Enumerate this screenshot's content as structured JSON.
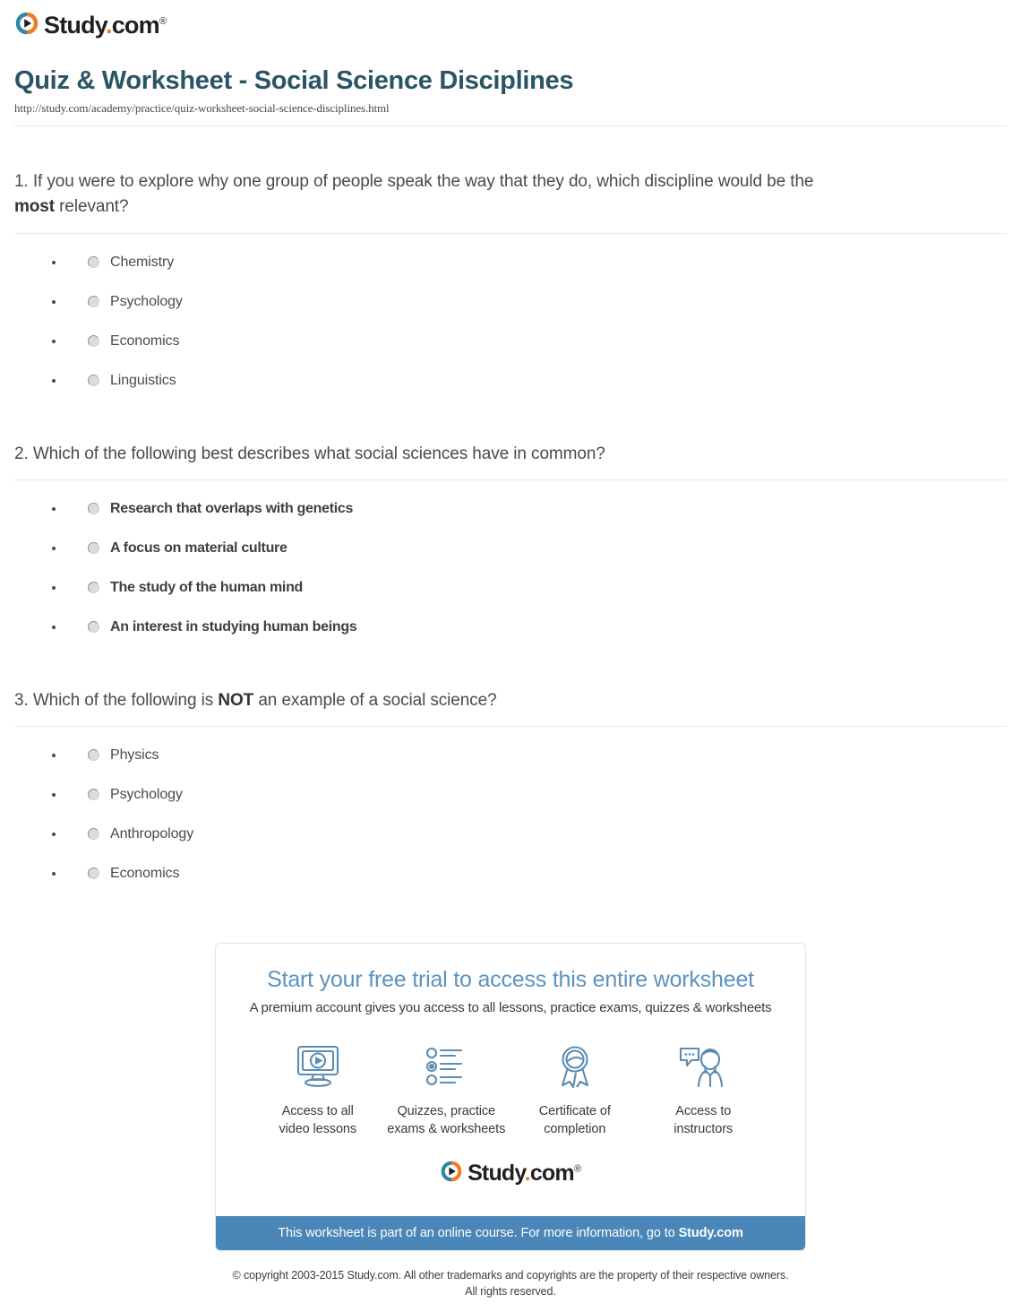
{
  "brand": {
    "name": "Study.com",
    "name_prefix": "Study",
    "name_dot": ".",
    "name_suffix": "com",
    "trademark": "®",
    "icon_name": "play-circle-logo-icon",
    "color_blue": "#2e86ab",
    "color_orange": "#f07c22"
  },
  "header": {
    "title": "Quiz & Worksheet - Social Science Disciplines",
    "url": "http://study.com/academy/practice/quiz-worksheet-social-science-disciplines.html"
  },
  "questions": [
    {
      "number": "1.",
      "text_before": "If you were to explore why one group of people speak the way that they do, which discipline would be the ",
      "emphasis": "most",
      "text_after": " relevant?",
      "bold_options": false,
      "options": [
        {
          "label": "Chemistry"
        },
        {
          "label": "Psychology"
        },
        {
          "label": "Economics"
        },
        {
          "label": "Linguistics"
        }
      ]
    },
    {
      "number": "2.",
      "text_before": "Which of the following best describes what social sciences have in common?",
      "emphasis": "",
      "text_after": "",
      "bold_options": true,
      "options": [
        {
          "label": "Research that overlaps with genetics"
        },
        {
          "label": "A focus on material culture"
        },
        {
          "label": "The study of the human mind"
        },
        {
          "label": "An interest in studying human beings"
        }
      ]
    },
    {
      "number": "3.",
      "text_before": "Which of the following is ",
      "emphasis": "NOT",
      "text_after": " an example of a social science?",
      "bold_options": false,
      "options": [
        {
          "label": "Physics"
        },
        {
          "label": "Psychology"
        },
        {
          "label": "Anthropology"
        },
        {
          "label": "Economics"
        }
      ]
    }
  ],
  "promo": {
    "headline": "Start your free trial to access this entire worksheet",
    "subhead": "A premium account gives you access to all lessons, practice exams, quizzes & worksheets",
    "features": [
      {
        "icon": "monitor-play-icon",
        "line1": "Access to all",
        "line2": "video lessons"
      },
      {
        "icon": "quiz-list-icon",
        "line1": "Quizzes, practice",
        "line2": "exams & worksheets"
      },
      {
        "icon": "award-ribbon-icon",
        "line1": "Certificate of",
        "line2": "completion"
      },
      {
        "icon": "instructor-chat-icon",
        "line1": "Access to",
        "line2": "instructors"
      }
    ],
    "bar_text": "This worksheet is part of an online course. For more information, go to ",
    "bar_brand": "Study.com",
    "bar_color": "#4a86b8"
  },
  "footer": {
    "line1": "© copyright 2003-2015 Study.com. All other trademarks and copyrights are the property of their respective owners.",
    "line2": "All rights reserved."
  }
}
